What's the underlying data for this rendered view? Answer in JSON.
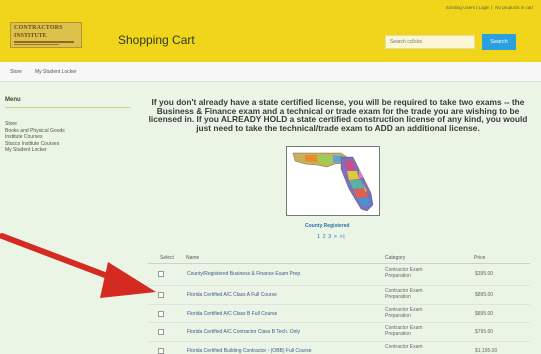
{
  "header": {
    "top_links": [
      "Existing Users | Login |",
      "No products in cart"
    ],
    "logo": {
      "line1": "CONTRACTORS",
      "line2": "INSTITUTE"
    },
    "page_title": "Shopping Cart",
    "search": {
      "placeholder": "Search cclicks",
      "button_label": "Search"
    },
    "colors": {
      "bar": "#f1d51b",
      "search_button": "#2aa1de"
    }
  },
  "nav": {
    "items": [
      "Store",
      "My Student Locker"
    ]
  },
  "sidebar": {
    "title": "Menu",
    "items": [
      "Store",
      "Books and Physical Goods",
      "Institute Courses",
      "Stucco Institute Courses",
      "My Student Locker"
    ]
  },
  "main": {
    "intro": "If you don't already have a state certified license, you will be required to take two exams -- the Business & Finance exam and a technical or trade exam for the trade you are wishing to be licensed in. If you ALREADY HOLD a state certified construction license of any kind, you would just need to take the technical/trade exam to ADD an additional license.",
    "map_caption": "County Registered",
    "pager": "1 2 3 > >|",
    "table": {
      "headers": [
        "Select",
        "Name",
        "Category",
        "Price"
      ],
      "rows": [
        {
          "name": "County/Registered Business & Finance Exam Prep",
          "category": "Contractor Exam Preparation",
          "price": "$395.00"
        },
        {
          "name": "Florida Certified A/C Class A Full Course",
          "category": "Contractor Exam Preparation",
          "price": "$895.00"
        },
        {
          "name": "Florida Certified A/C Class B Full Course",
          "category": "Contractor Exam Preparation",
          "price": "$895.00"
        },
        {
          "name": "Florida Certified A/C Contractor Class B Tech. Only",
          "category": "Contractor Exam Preparation",
          "price": "$795.00"
        },
        {
          "name": "Florida Certified Building Contractor - (OBB) Full Course",
          "category": "Contractor Exam",
          "price": "$1,195.00"
        }
      ]
    }
  },
  "annotation": {
    "arrow_color": "#d42a22"
  }
}
